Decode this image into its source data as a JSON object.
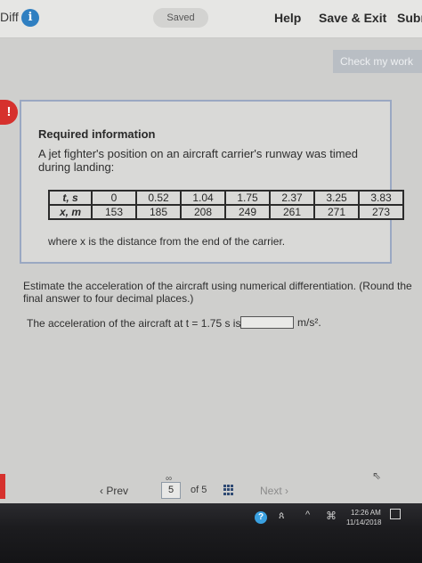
{
  "header": {
    "diff_label": "Diff",
    "saved": "Saved",
    "help": "Help",
    "save_exit": "Save & Exit",
    "submit": "Subm"
  },
  "check_button": "Check my work",
  "info": {
    "title": "Required information",
    "description": "A jet fighter's position on an aircraft carrier's runway was timed during landing:",
    "table": {
      "row1_header": "t, s",
      "row1": [
        "0",
        "0.52",
        "1.04",
        "1.75",
        "2.37",
        "3.25",
        "3.83"
      ],
      "row2_header": "x, m",
      "row2": [
        "153",
        "185",
        "208",
        "249",
        "261",
        "271",
        "273"
      ]
    },
    "where": "where x is the distance from the end of the carrier."
  },
  "question": {
    "instruction": "Estimate the acceleration of the aircraft using numerical differentiation. (Round the final answer to four decimal places.)",
    "prompt": "The acceleration of the aircraft at t = 1.75 s is",
    "answer_value": "",
    "unit": "m/s²."
  },
  "nav": {
    "prev": "‹  Prev",
    "page": "5",
    "of": "of 5",
    "next": "Next  ›"
  },
  "taskbar": {
    "time": "12:26 AM",
    "date": "11/14/2018"
  },
  "colors": {
    "alert_red": "#d6312d",
    "info_blue": "#2f7fc1",
    "card_border": "#9aa8c2"
  }
}
